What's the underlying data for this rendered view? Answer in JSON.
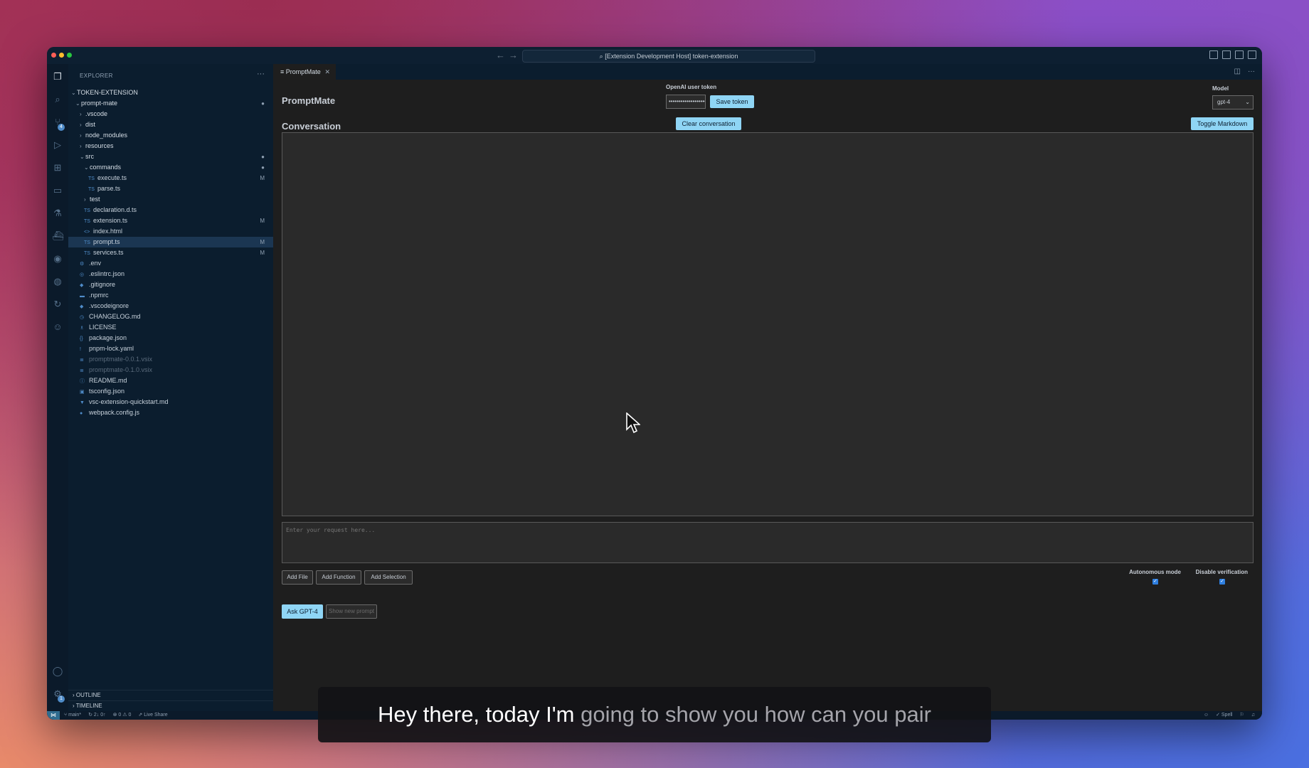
{
  "window": {
    "title": "[Extension Development Host] token-extension"
  },
  "activity_bar": {
    "source_control_badge": "4",
    "settings_badge": "1"
  },
  "explorer": {
    "title": "EXPLORER",
    "workspace": "TOKEN-EXTENSION",
    "rows": [
      {
        "label": "prompt-mate",
        "indent": 1,
        "chev": "⌄",
        "folder": true,
        "mark": "●"
      },
      {
        "label": ".vscode",
        "indent": 2,
        "chev": "›",
        "folder": true
      },
      {
        "label": "dist",
        "indent": 2,
        "chev": "›",
        "folder": true,
        "dim": true
      },
      {
        "label": "node_modules",
        "indent": 2,
        "chev": "›",
        "folder": true,
        "dim": true
      },
      {
        "label": "resources",
        "indent": 2,
        "chev": "›",
        "folder": true
      },
      {
        "label": "src",
        "indent": 2,
        "chev": "⌄",
        "folder": true,
        "mark": "●"
      },
      {
        "label": "commands",
        "indent": 3,
        "chev": "⌄",
        "folder": true,
        "mark": "●"
      },
      {
        "label": "execute.ts",
        "indent": 4,
        "icon": "TS",
        "mark": "M"
      },
      {
        "label": "parse.ts",
        "indent": 4,
        "icon": "TS"
      },
      {
        "label": "test",
        "indent": 3,
        "chev": "›",
        "folder": true
      },
      {
        "label": "declaration.d.ts",
        "indent": 3,
        "icon": "TS"
      },
      {
        "label": "extension.ts",
        "indent": 3,
        "icon": "TS",
        "mark": "M"
      },
      {
        "label": "index.html",
        "indent": 3,
        "icon": "<>"
      },
      {
        "label": "prompt.ts",
        "indent": 3,
        "icon": "TS",
        "mark": "M",
        "selected": true
      },
      {
        "label": "services.ts",
        "indent": 3,
        "icon": "TS",
        "mark": "M"
      },
      {
        "label": ".env",
        "indent": 2,
        "icon": "⚙"
      },
      {
        "label": ".eslintrc.json",
        "indent": 2,
        "icon": "◎"
      },
      {
        "label": ".gitignore",
        "indent": 2,
        "icon": "◆"
      },
      {
        "label": ".npmrc",
        "indent": 2,
        "icon": "▬"
      },
      {
        "label": ".vscodeignore",
        "indent": 2,
        "icon": "◆"
      },
      {
        "label": "CHANGELOG.md",
        "indent": 2,
        "icon": "◷"
      },
      {
        "label": "LICENSE",
        "indent": 2,
        "icon": "♗"
      },
      {
        "label": "package.json",
        "indent": 2,
        "icon": "{}"
      },
      {
        "label": "pnpm-lock.yaml",
        "indent": 2,
        "icon": "!"
      },
      {
        "label": "promptmate-0.0.1.vsix",
        "indent": 2,
        "icon": "≣",
        "dim": true
      },
      {
        "label": "promptmate-0.1.0.vsix",
        "indent": 2,
        "icon": "≣",
        "dim": true
      },
      {
        "label": "README.md",
        "indent": 2,
        "icon": "ⓘ"
      },
      {
        "label": "tsconfig.json",
        "indent": 2,
        "icon": "▣"
      },
      {
        "label": "vsc-extension-quickstart.md",
        "indent": 2,
        "icon": "▼"
      },
      {
        "label": "webpack.config.js",
        "indent": 2,
        "icon": "●"
      }
    ],
    "outline": "OUTLINE",
    "timeline": "TIMELINE"
  },
  "editor": {
    "tab_label": "PromptMate",
    "tab_close": "✕"
  },
  "promptmate": {
    "title": "PromptMate",
    "conversation_title": "Conversation",
    "token_label": "OpenAI user token",
    "token_value": "••••••••••••••••••••••",
    "save_token": "Save token",
    "model_label": "Model",
    "model_value": "gpt-4",
    "clear_conversation": "Clear conversation",
    "toggle_markdown": "Toggle Markdown",
    "request_placeholder": "Enter your request here...",
    "add_file": "Add File",
    "add_function": "Add Function",
    "add_selection": "Add Selection",
    "autonomous_mode": "Autonomous mode",
    "disable_verification": "Disable verification",
    "ask_button": "Ask GPT-4",
    "show_prompt": "Show new prompt"
  },
  "status_bar": {
    "branch": "main*",
    "sync": "2↓ 0↑",
    "problems": "⊗ 0 ⚠ 0",
    "live_share": "Live Share",
    "spell": "✓ Spell"
  },
  "caption": {
    "spoken": "Hey there, today I'm",
    "upcoming": "going to show you how can you pair"
  },
  "icons": {
    "explorer": "files-icon",
    "search": "search-icon",
    "source_control": "source-control-icon",
    "run": "run-debug-icon",
    "extensions": "extensions-icon",
    "remote": "remote-explorer-icon",
    "testing": "testing-flask-icon",
    "docker": "docker-icon",
    "account": "account-icon",
    "settings": "gear-icon"
  }
}
